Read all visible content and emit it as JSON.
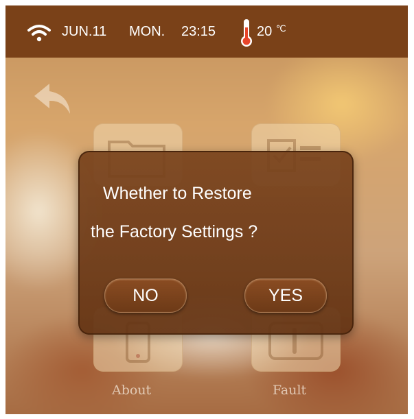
{
  "status_bar": {
    "date": "JUN.11",
    "day": "MON.",
    "time": "23:15",
    "temperature": "20",
    "temperature_unit": "℃"
  },
  "background_tiles": {
    "left_label": "About",
    "right_label": "Fault"
  },
  "dialog": {
    "message_line1": "Whether to Restore",
    "message_line2": "the Factory Settings ?",
    "no_label": "NO",
    "yes_label": "YES"
  },
  "colors": {
    "status_bar_bg": "#7a4118",
    "dialog_bg": "#6e3b18",
    "text": "#ffffff"
  }
}
